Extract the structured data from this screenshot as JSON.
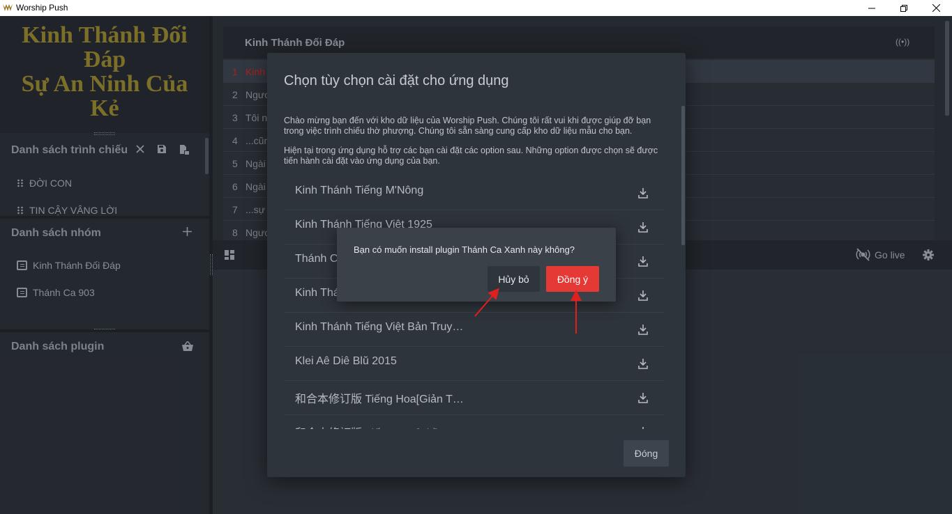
{
  "window": {
    "title": "Worship Push"
  },
  "sidebar": {
    "logo_lines": [
      "Kinh Thánh Đối",
      "Đáp",
      "Sự An Ninh Của",
      "Kẻ"
    ],
    "presentation": {
      "title": "Danh sách trình chiếu",
      "items": [
        "ĐỜI CON",
        "TIN CẬY VÂNG LỜI"
      ]
    },
    "groups": {
      "title": "Danh sách nhóm",
      "items": [
        "Kinh Thánh Đối Đáp",
        "Thánh Ca 903"
      ]
    },
    "plugins": {
      "title": "Danh sách plugin"
    }
  },
  "lyrics": {
    "header": "Kinh Thánh Đối Đáp",
    "rows": [
      {
        "n": "1",
        "text": "Kinh"
      },
      {
        "n": "2",
        "text": "Ngươ"
      },
      {
        "n": "3",
        "text": "Tôi n"
      },
      {
        "n": "4",
        "text": "...cũn"
      },
      {
        "n": "5",
        "text": "Ngài"
      },
      {
        "n": "6",
        "text": "Ngài"
      },
      {
        "n": "7",
        "text": "...sự"
      },
      {
        "n": "8",
        "text": "Ngươ"
      }
    ]
  },
  "toolbar": {
    "go_live": "Go live"
  },
  "setup_dialog": {
    "title": "Chọn tùy chọn cài đặt cho ứng dụng",
    "para1": "Chào mừng bạn đến với kho dữ liệu của Worship Push. Chúng tôi rất vui khi được giúp đỡ bạn trong việc trình chiếu thờ phượng. Chúng tôi sẵn sàng cung cấp kho dữ liệu mẫu cho bạn.",
    "para2": "Hiện tại trong ứng dụng hỗ trợ các bạn cài đặt các option sau. Những option được chọn sẽ được tiến hành cài đặt vào ứng dụng của bạn.",
    "options": [
      "Kinh Thánh Tiếng M'Nông",
      "Kinh Thánh Tiếng Việt 1925",
      "Thánh C",
      "Kinh Thá",
      "Kinh Thánh Tiếng Việt Bản Truy…",
      "Klei Aê Diê Blŭ 2015",
      "和合本修订版 Tiếng Hoa[Giản T…",
      "和合本修訂版 Tiếng Hoa[Phồn"
    ],
    "close_label": "Đóng"
  },
  "confirm_dialog": {
    "message": "Bạn có muốn install plugin Thánh Ca Xanh này không?",
    "cancel_label": "Hủy bỏ",
    "ok_label": "Đồng ý"
  },
  "colors": {
    "accent_red": "#e53935",
    "logo_gold": "#8e7f2e",
    "annotation_arrow": "#e0201f"
  }
}
